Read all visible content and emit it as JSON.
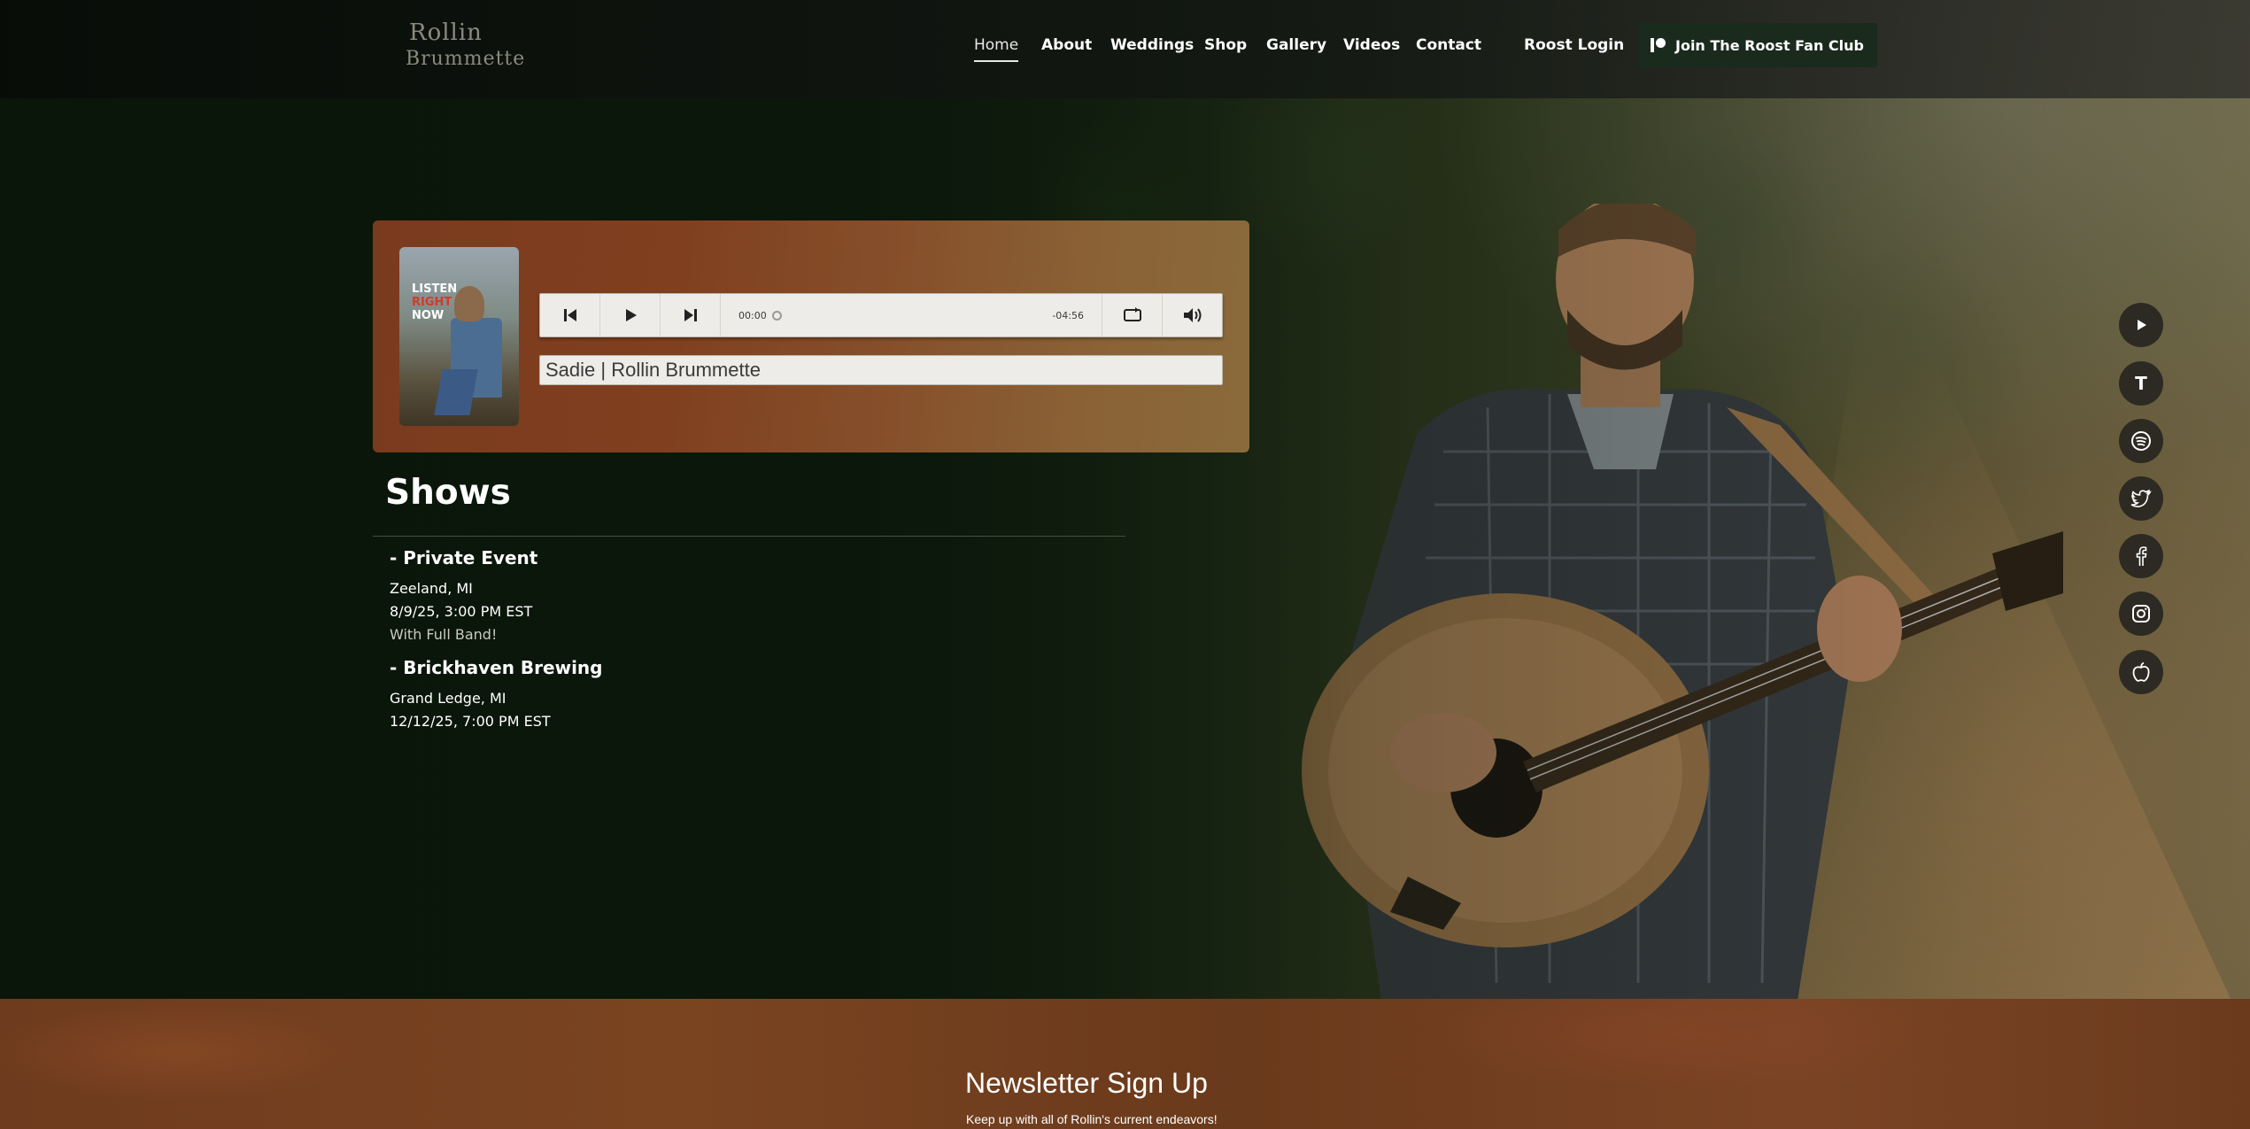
{
  "logo": {
    "line1": "Rollin",
    "line2": "Brummette"
  },
  "nav": {
    "items": [
      "Home",
      "About",
      "Weddings",
      "Shop",
      "Gallery",
      "Videos",
      "Contact"
    ],
    "active": "Home",
    "roost_login": "Roost Login",
    "join_label": "Join The Roost Fan Club"
  },
  "player": {
    "album_text": {
      "line1": "LISTEN",
      "line2": "RIGHT",
      "line3": "NOW"
    },
    "time_current": "00:00",
    "time_remaining": "-04:56",
    "progress_fraction": 0,
    "track_title": "Sadie | Rollin Brummette"
  },
  "shows": {
    "heading": "Shows",
    "items": [
      {
        "title": "- Private Event",
        "location": "Zeeland, MI",
        "date": "8/9/25, 3:00 PM EST",
        "note": "With Full Band!"
      },
      {
        "title": "- Brickhaven Brewing",
        "location": "Grand Ledge, MI",
        "date": "12/12/25, 7:00 PM EST",
        "note": ""
      }
    ]
  },
  "social": {
    "icons": [
      "youtube-icon",
      "t-icon",
      "spotify-icon",
      "twitter-icon",
      "facebook-icon",
      "instagram-icon",
      "apple-icon"
    ],
    "t_label": "T"
  },
  "newsletter": {
    "title": "Newsletter Sign Up",
    "subtitle": "Keep up with all of Rollin's current endeavors!"
  },
  "colors": {
    "header_bg": "#0b100b",
    "join_button": "#1a2a1c",
    "player_card_start": "#7a3a1e",
    "player_card_end": "#8a6a3b",
    "newsletter_bg": "#74401f"
  }
}
